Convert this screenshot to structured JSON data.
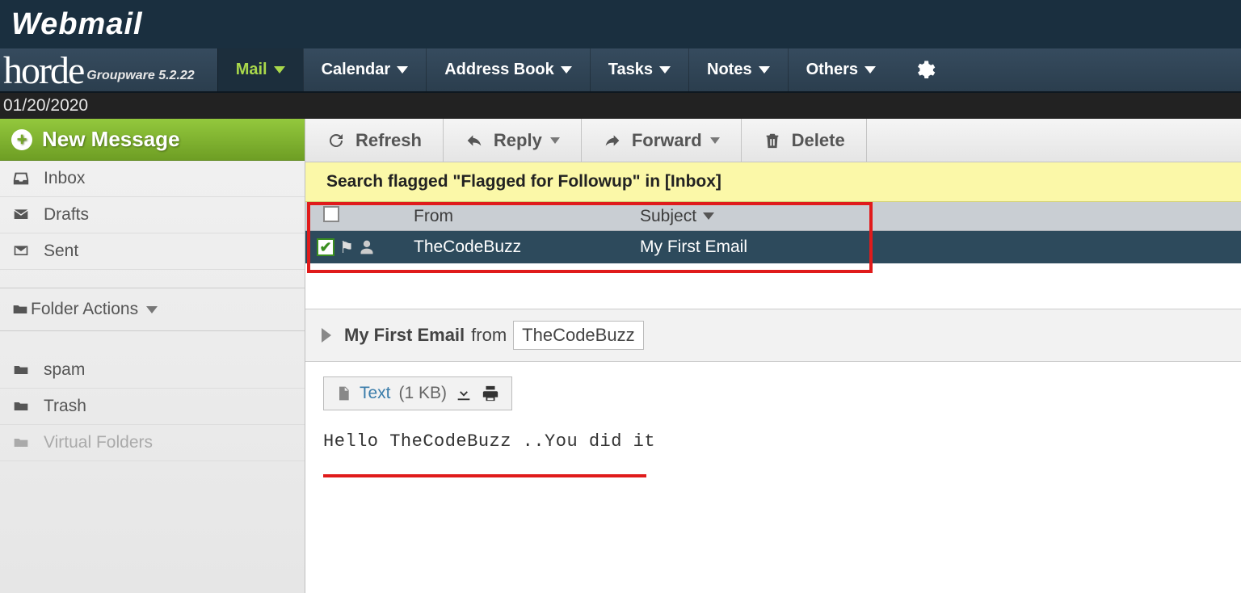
{
  "branding": {
    "webmail_logo": "Webmail",
    "horde_word": "horde",
    "horde_version": "Groupware 5.2.22"
  },
  "nav": {
    "mail": "Mail",
    "calendar": "Calendar",
    "address_book": "Address Book",
    "tasks": "Tasks",
    "notes": "Notes",
    "others": "Others"
  },
  "datebar": "01/20/2020",
  "sidebar": {
    "new_message": "New Message",
    "inbox": "Inbox",
    "drafts": "Drafts",
    "sent": "Sent",
    "folder_actions": "Folder Actions",
    "spam": "spam",
    "trash": "Trash",
    "virtual": "Virtual Folders"
  },
  "toolbar": {
    "refresh": "Refresh",
    "reply": "Reply",
    "forward": "Forward",
    "delete": "Delete"
  },
  "search_banner": "Search flagged \"Flagged for Followup\" in [Inbox]",
  "list": {
    "header_from": "From",
    "header_subject": "Subject",
    "row_from": "TheCodeBuzz",
    "row_subject": "My First Email"
  },
  "preview": {
    "subject": "My First Email",
    "from_word": "from",
    "from_value": "TheCodeBuzz",
    "attach_text": "Text",
    "attach_size": "(1 KB)",
    "body": "Hello TheCodeBuzz ..You did it"
  }
}
